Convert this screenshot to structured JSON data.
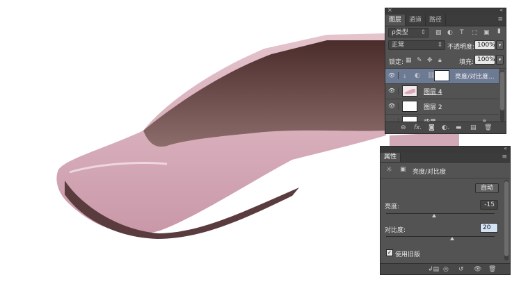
{
  "layers_panel": {
    "tabs": [
      "图层",
      "通道",
      "路径"
    ],
    "filter_kind": "ρ类型",
    "blend_mode": "正常",
    "opacity_label": "不透明度:",
    "opacity_value": "100%",
    "lock_label": "锁定:",
    "fill_label": "填充:",
    "fill_value": "100%",
    "layers": [
      {
        "name": "亮度/对比度...",
        "selected": true
      },
      {
        "name": "图层 4",
        "selected": false
      },
      {
        "name": "图层 2",
        "selected": false
      },
      {
        "name": "背景",
        "selected": false
      }
    ]
  },
  "properties_panel": {
    "tab": "属性",
    "adjustment_title": "亮度/对比度",
    "auto_button": "自动",
    "brightness_label": "亮度:",
    "brightness_value": "-15",
    "contrast_label": "对比度:",
    "contrast_value": "20",
    "legacy_label": "使用旧版",
    "legacy_checked": true
  },
  "colors": {
    "panel_bg": "#535353",
    "selected_layer": "#6d7a94",
    "shoe_pink": "#d9b1bd",
    "shoe_inner": "#6b4a48"
  }
}
